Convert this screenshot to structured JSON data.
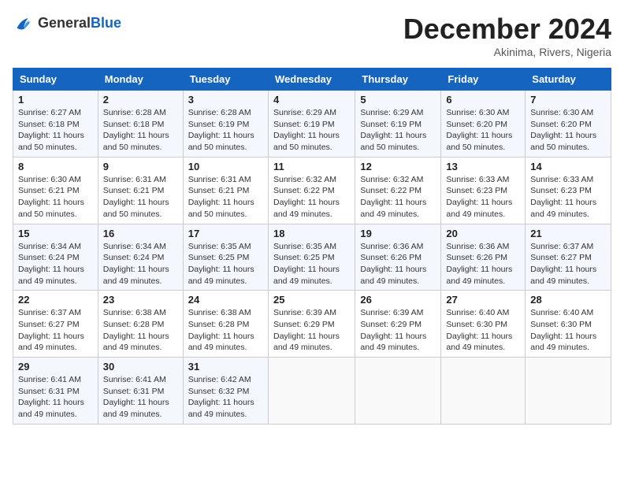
{
  "header": {
    "logo": {
      "general": "General",
      "blue": "Blue"
    },
    "month_year": "December 2024",
    "location": "Akinima, Rivers, Nigeria"
  },
  "days_of_week": [
    "Sunday",
    "Monday",
    "Tuesday",
    "Wednesday",
    "Thursday",
    "Friday",
    "Saturday"
  ],
  "weeks": [
    [
      {
        "day": "1",
        "sunrise": "6:27 AM",
        "sunset": "6:18 PM",
        "daylight": "11 hours and 50 minutes."
      },
      {
        "day": "2",
        "sunrise": "6:28 AM",
        "sunset": "6:18 PM",
        "daylight": "11 hours and 50 minutes."
      },
      {
        "day": "3",
        "sunrise": "6:28 AM",
        "sunset": "6:19 PM",
        "daylight": "11 hours and 50 minutes."
      },
      {
        "day": "4",
        "sunrise": "6:29 AM",
        "sunset": "6:19 PM",
        "daylight": "11 hours and 50 minutes."
      },
      {
        "day": "5",
        "sunrise": "6:29 AM",
        "sunset": "6:19 PM",
        "daylight": "11 hours and 50 minutes."
      },
      {
        "day": "6",
        "sunrise": "6:30 AM",
        "sunset": "6:20 PM",
        "daylight": "11 hours and 50 minutes."
      },
      {
        "day": "7",
        "sunrise": "6:30 AM",
        "sunset": "6:20 PM",
        "daylight": "11 hours and 50 minutes."
      }
    ],
    [
      {
        "day": "8",
        "sunrise": "6:30 AM",
        "sunset": "6:21 PM",
        "daylight": "11 hours and 50 minutes."
      },
      {
        "day": "9",
        "sunrise": "6:31 AM",
        "sunset": "6:21 PM",
        "daylight": "11 hours and 50 minutes."
      },
      {
        "day": "10",
        "sunrise": "6:31 AM",
        "sunset": "6:21 PM",
        "daylight": "11 hours and 50 minutes."
      },
      {
        "day": "11",
        "sunrise": "6:32 AM",
        "sunset": "6:22 PM",
        "daylight": "11 hours and 49 minutes."
      },
      {
        "day": "12",
        "sunrise": "6:32 AM",
        "sunset": "6:22 PM",
        "daylight": "11 hours and 49 minutes."
      },
      {
        "day": "13",
        "sunrise": "6:33 AM",
        "sunset": "6:23 PM",
        "daylight": "11 hours and 49 minutes."
      },
      {
        "day": "14",
        "sunrise": "6:33 AM",
        "sunset": "6:23 PM",
        "daylight": "11 hours and 49 minutes."
      }
    ],
    [
      {
        "day": "15",
        "sunrise": "6:34 AM",
        "sunset": "6:24 PM",
        "daylight": "11 hours and 49 minutes."
      },
      {
        "day": "16",
        "sunrise": "6:34 AM",
        "sunset": "6:24 PM",
        "daylight": "11 hours and 49 minutes."
      },
      {
        "day": "17",
        "sunrise": "6:35 AM",
        "sunset": "6:25 PM",
        "daylight": "11 hours and 49 minutes."
      },
      {
        "day": "18",
        "sunrise": "6:35 AM",
        "sunset": "6:25 PM",
        "daylight": "11 hours and 49 minutes."
      },
      {
        "day": "19",
        "sunrise": "6:36 AM",
        "sunset": "6:26 PM",
        "daylight": "11 hours and 49 minutes."
      },
      {
        "day": "20",
        "sunrise": "6:36 AM",
        "sunset": "6:26 PM",
        "daylight": "11 hours and 49 minutes."
      },
      {
        "day": "21",
        "sunrise": "6:37 AM",
        "sunset": "6:27 PM",
        "daylight": "11 hours and 49 minutes."
      }
    ],
    [
      {
        "day": "22",
        "sunrise": "6:37 AM",
        "sunset": "6:27 PM",
        "daylight": "11 hours and 49 minutes."
      },
      {
        "day": "23",
        "sunrise": "6:38 AM",
        "sunset": "6:28 PM",
        "daylight": "11 hours and 49 minutes."
      },
      {
        "day": "24",
        "sunrise": "6:38 AM",
        "sunset": "6:28 PM",
        "daylight": "11 hours and 49 minutes."
      },
      {
        "day": "25",
        "sunrise": "6:39 AM",
        "sunset": "6:29 PM",
        "daylight": "11 hours and 49 minutes."
      },
      {
        "day": "26",
        "sunrise": "6:39 AM",
        "sunset": "6:29 PM",
        "daylight": "11 hours and 49 minutes."
      },
      {
        "day": "27",
        "sunrise": "6:40 AM",
        "sunset": "6:30 PM",
        "daylight": "11 hours and 49 minutes."
      },
      {
        "day": "28",
        "sunrise": "6:40 AM",
        "sunset": "6:30 PM",
        "daylight": "11 hours and 49 minutes."
      }
    ],
    [
      {
        "day": "29",
        "sunrise": "6:41 AM",
        "sunset": "6:31 PM",
        "daylight": "11 hours and 49 minutes."
      },
      {
        "day": "30",
        "sunrise": "6:41 AM",
        "sunset": "6:31 PM",
        "daylight": "11 hours and 49 minutes."
      },
      {
        "day": "31",
        "sunrise": "6:42 AM",
        "sunset": "6:32 PM",
        "daylight": "11 hours and 49 minutes."
      },
      null,
      null,
      null,
      null
    ]
  ]
}
